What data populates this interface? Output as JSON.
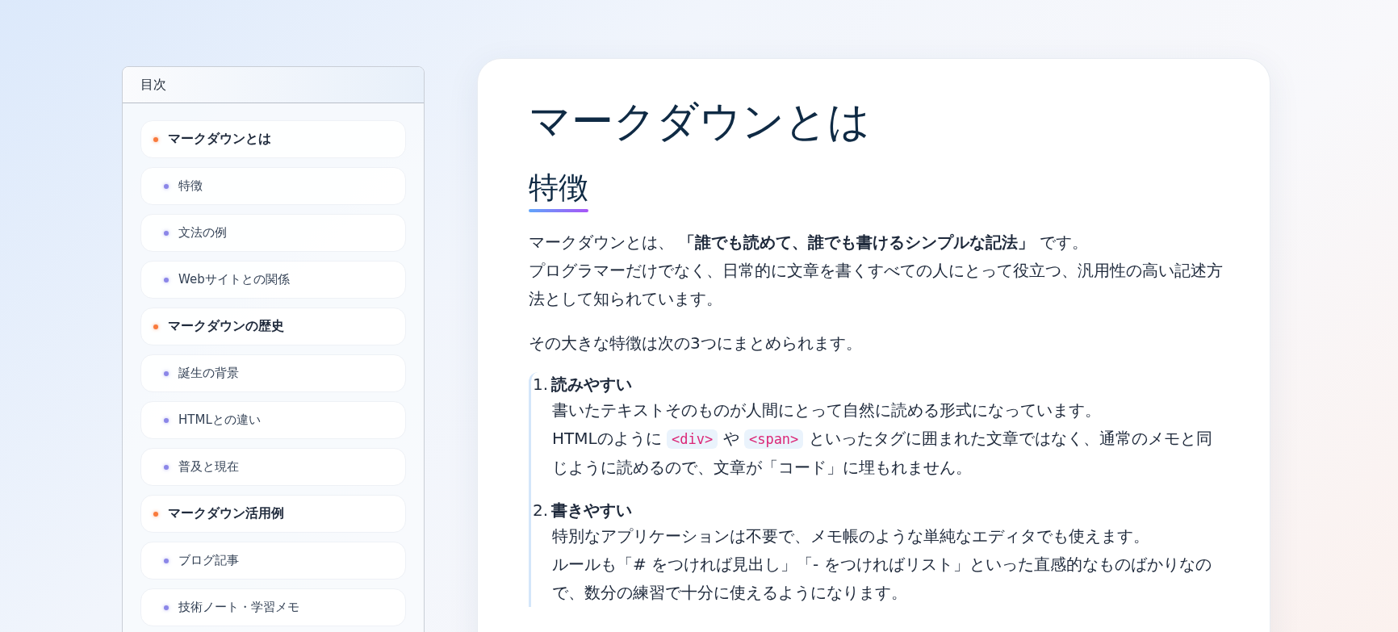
{
  "toc": {
    "title": "目次",
    "items": [
      {
        "kind": "section",
        "label": "マークダウンとは"
      },
      {
        "kind": "subsection",
        "label": "特徴"
      },
      {
        "kind": "subsection",
        "label": "文法の例"
      },
      {
        "kind": "subsection",
        "label": "Webサイトとの関係"
      },
      {
        "kind": "section",
        "label": "マークダウンの歴史"
      },
      {
        "kind": "subsection",
        "label": "誕生の背景"
      },
      {
        "kind": "subsection",
        "label": "HTMLとの違い"
      },
      {
        "kind": "subsection",
        "label": "普及と現在"
      },
      {
        "kind": "section",
        "label": "マークダウン活用例"
      },
      {
        "kind": "subsection",
        "label": "ブログ記事"
      },
      {
        "kind": "subsection",
        "label": "技術ノート・学習メモ"
      }
    ]
  },
  "article": {
    "title": "マークダウンとは",
    "heading": "特徴",
    "paragraphs": [
      [
        "マークダウンとは、 **「誰でも読めて、誰でも書けるシンプルな記法」** です。",
        "プログラマーだけでなく、日常的に文章を書くすべての人にとって役立つ、汎用性の高い記述方法として知られています。"
      ],
      [
        "その大きな特徴は次の3つにまとめられます。"
      ]
    ],
    "list": [
      {
        "number": "1.",
        "title": "読みやすい",
        "lines": [
          [
            {
              "kind": "text",
              "text": "書いたテキストそのものが人間にとって自然に読める形式になっています。"
            }
          ],
          [
            {
              "kind": "text",
              "text": "HTMLのように "
            },
            {
              "kind": "code",
              "text": "<div>"
            },
            {
              "kind": "text",
              "text": " や "
            },
            {
              "kind": "code",
              "text": "<span>"
            },
            {
              "kind": "text",
              "text": " といったタグに囲まれた文章ではなく、通常のメモと同じように読めるので、文章が「コード」に埋もれません。"
            }
          ]
        ]
      },
      {
        "number": "2.",
        "title": "書きやすい",
        "lines": [
          [
            {
              "kind": "text",
              "text": "特別なアプリケーションは不要で、メモ帳のような単純なエディタでも使えます。"
            }
          ],
          [
            {
              "kind": "text",
              "text": "ルールも「# をつければ見出し」「- をつければリスト」といった直感的なものばかりなので、数分の練習で十分に使えるようになります。"
            }
          ]
        ]
      }
    ]
  }
}
